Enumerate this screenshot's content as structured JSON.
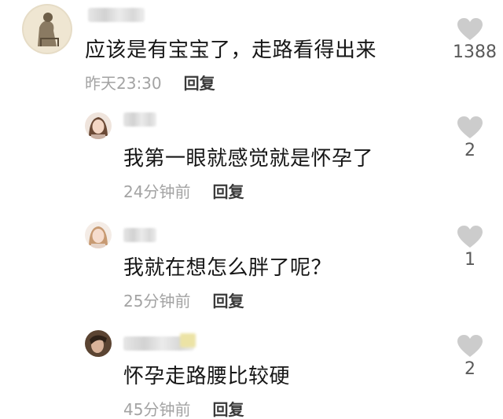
{
  "comments": [
    {
      "text": "应该是有宝宝了，走路看得出来",
      "time": "昨天23:30",
      "reply_label": "回复",
      "like_count": "1388",
      "avatar_icon": "vintage-photo-avatar"
    },
    {
      "text": "我第一眼就感觉就是怀孕了",
      "time": "24分钟前",
      "reply_label": "回复",
      "like_count": "2",
      "avatar_icon": "girl-portrait-avatar"
    },
    {
      "text": "我就在想怎么胖了呢？",
      "time": "25分钟前",
      "reply_label": "回复",
      "like_count": "1",
      "avatar_icon": "girl-portrait-avatar"
    },
    {
      "text": "怀孕走路腰比较硬",
      "time": "45分钟前",
      "reply_label": "回复",
      "like_count": "2",
      "avatar_icon": "person-photo-avatar"
    }
  ],
  "colors": {
    "text": "#161616",
    "meta": "#a3a3a3",
    "reply": "#3a3a3a",
    "heart": "#cccccc"
  },
  "icons": {
    "like": "heart-icon"
  }
}
